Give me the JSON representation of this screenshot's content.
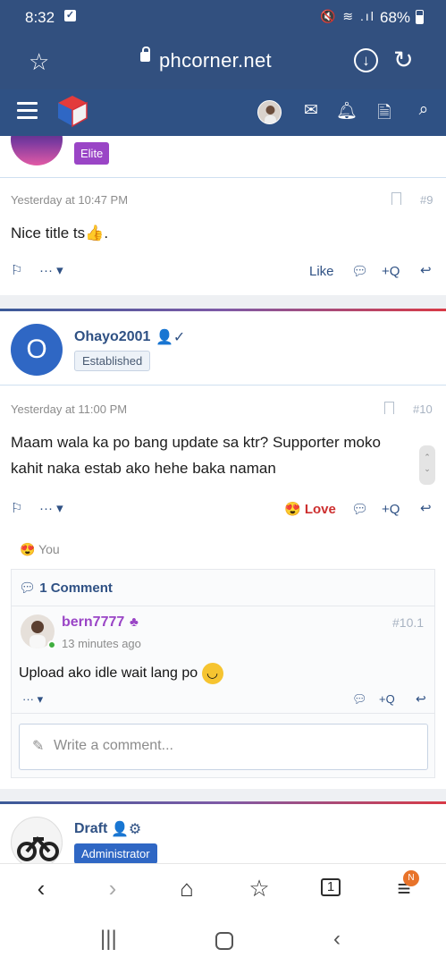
{
  "status_bar": {
    "time": "8:32",
    "battery": "68%"
  },
  "browser": {
    "url": "phcorner.net"
  },
  "post_prev": {
    "badge": "Elite",
    "date": "Yesterday at 10:47 PM",
    "number": "#9",
    "text": "Nice title ts",
    "emoji": "👍",
    "text_end": ".",
    "like_label": "Like",
    "quote_label": "+Q"
  },
  "post_main": {
    "avatar_letter": "O",
    "username": "Ohayo2001",
    "badge": "Established",
    "date": "Yesterday at 11:00 PM",
    "number": "#10",
    "text": "Maam wala ka po bang update sa ktr? Supporter moko kahit naka estab ako hehe baka naman",
    "love_label": "Love",
    "quote_label": "+Q",
    "reaction_by": "You",
    "comments_count": "1 Comment"
  },
  "comment": {
    "username": "bern7777",
    "time": "13 minutes ago",
    "number": "#10.1",
    "text": "Upload ako idle wait lang po",
    "quote_label": "+Q",
    "write_placeholder": "Write a comment..."
  },
  "post_next": {
    "username": "Draft",
    "badge": "Administrator"
  },
  "colors": {
    "header": "#2f5184",
    "accent": "#cd2f2f",
    "elite": "#9a45c6"
  }
}
